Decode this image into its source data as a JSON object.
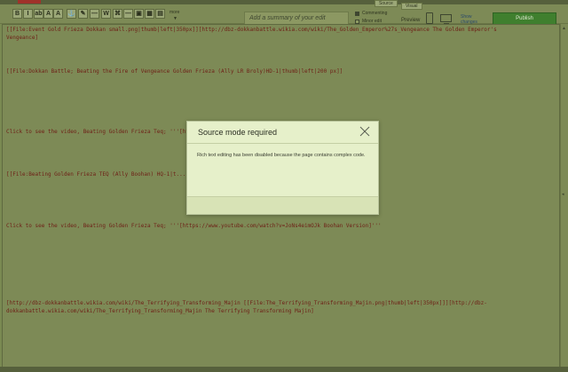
{
  "toolbar": {
    "more_label": "more",
    "more_arrow": "▼",
    "summary_placeholder": "Add a summary of your edit",
    "commenting_label": "Commenting",
    "minor_edit_label": "Minor edit",
    "source_tab": "Source",
    "visual_tab": "Visual",
    "preview_label": "Preview",
    "show_changes_line1": "Show",
    "show_changes_line2": "changes",
    "publish_label": "Publish",
    "buttons": [
      {
        "name": "bold-button",
        "label": "B"
      },
      {
        "name": "italic-button",
        "label": "I"
      },
      {
        "name": "ab-button",
        "label": "ab"
      },
      {
        "name": "format-a-button",
        "label": "A"
      },
      {
        "name": "format-a2-button",
        "label": "A"
      },
      {
        "name": "link-button",
        "label": "⚓"
      },
      {
        "name": "signature-button",
        "label": "✎"
      },
      {
        "name": "dash-button",
        "label": "—"
      },
      {
        "name": "wiki-button",
        "label": "W"
      },
      {
        "name": "code-button",
        "label": "⌘"
      },
      {
        "name": "hr-button",
        "label": "—"
      },
      {
        "name": "image-button",
        "label": "▣"
      },
      {
        "name": "gallery-button",
        "label": "▦"
      },
      {
        "name": "table-button",
        "label": "▤"
      }
    ],
    "colors": {
      "publish": "#3f7f2e",
      "link": "#2b4a6a"
    }
  },
  "editor": {
    "lines": [
      "[[File:Event Gold Frieza Dokkan small.png|thumb|left|350px]][http://dbz-dokkanbattle.wikia.com/wiki/The_Golden_Emperor%27s_Vengeance The Golden Emperor's",
      "Vengeance]",
      "[[File:Dokkan Battle; Beating the Fire of Vengeance Golden Frieza (Ally LR Broly)HD-1|thumb|left|200 px]]",
      "Click to see the video, Beating Golden Frieza Teq; '''[https://www.youtube.com/watch?v=... Version]'''",
      "[[File:Beating Golden Frieza TEQ (Ally Boohan) HQ-1|t...",
      "Click to see the video, Beating Golden Frieza Teq; '''[https://www.youtube.com/watch?v=JoNs4eimOJk Boohan Version]'''",
      "[http://dbz-dokkanbattle.wikia.com/wiki/The_Terrifying_Transforming_Majin [[File:The_Terrifying_Transforming_Majin.png|thumb|left|350px]]][http://dbz-",
      "dokkanbattle.wikia.com/wiki/The_Terrifying_Transforming_Majin The Terrifying Transforming Majin]"
    ]
  },
  "modal": {
    "title": "Source mode required",
    "body": "Rich text editing has been disabled because the page contains complex code."
  },
  "scrollbar": {
    "up": "▲",
    "marker": "◂"
  }
}
